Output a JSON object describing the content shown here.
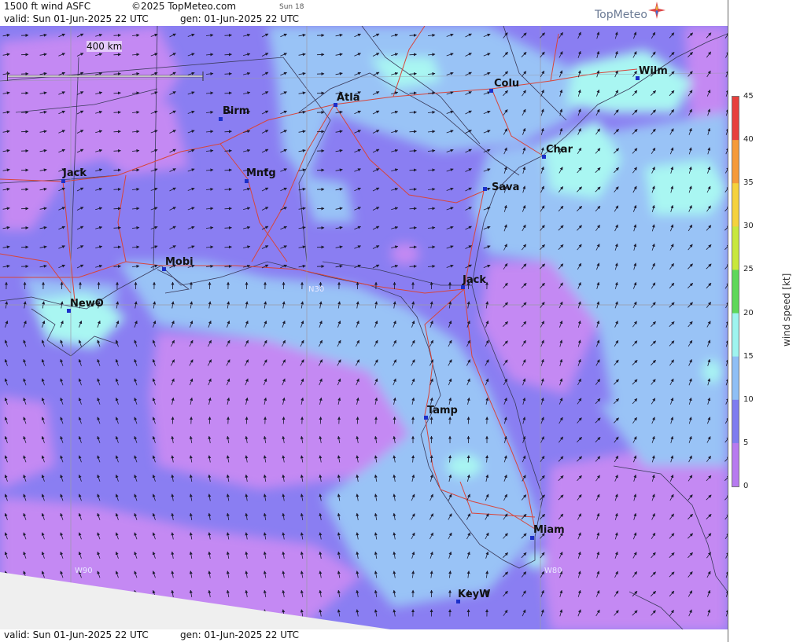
{
  "header": {
    "title": "1500 ft wind ASFC",
    "copyright": "©2025 TopMeteo.com",
    "run_tag": "Sun 18",
    "valid": "valid:  Sun  01-Jun-2025  22 UTC",
    "gen": "gen: 01-Jun-2025 22 UTC",
    "logo": "TopMeteo"
  },
  "footer": {
    "valid": "valid:  Sun  01-Jun-2025  22 UTC",
    "gen": "gen: 01-Jun-2025 22 UTC"
  },
  "scale": {
    "label": "400 km"
  },
  "cities": [
    {
      "name": "Jack"
    },
    {
      "name": "Birm"
    },
    {
      "name": "Atla"
    },
    {
      "name": "Colu"
    },
    {
      "name": "Wilm"
    },
    {
      "name": "Char"
    },
    {
      "name": "Mntg"
    },
    {
      "name": "Sava"
    },
    {
      "name": "Mobi"
    },
    {
      "name": "Jack"
    },
    {
      "name": "NewO"
    },
    {
      "name": "Tamp"
    },
    {
      "name": "Miam"
    },
    {
      "name": "KeyW"
    }
  ],
  "grid_labels": {
    "n30": "N30",
    "w90": "W90",
    "w80": "W80"
  },
  "colorbar": {
    "title": "wind speed [kt]",
    "ticks": [
      "45",
      "40",
      "35",
      "30",
      "25",
      "20",
      "15",
      "10",
      "5",
      "0"
    ],
    "colors": [
      "#e8403c",
      "#f59a3a",
      "#f5d23c",
      "#c8e83c",
      "#5fd85a",
      "#9ef4ef",
      "#8fbff5",
      "#7e7cf0",
      "#b77af0"
    ]
  },
  "palette": {
    "speed_0_5": "#c489f3",
    "speed_5_10": "#8a7ef2",
    "speed_10_15": "#99c3f6",
    "speed_15_20": "#a9f6f2",
    "grey_nodata": "#efefef"
  }
}
